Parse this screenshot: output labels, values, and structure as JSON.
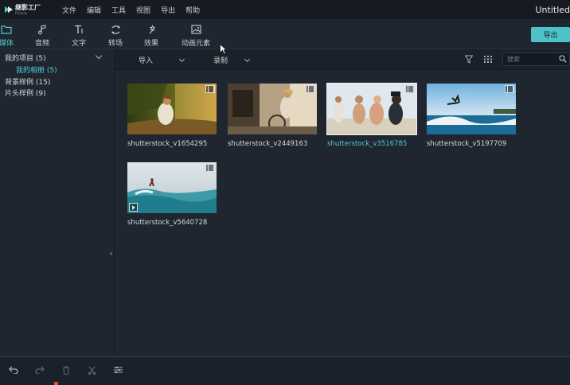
{
  "app": {
    "logo_cn": "继影工厂",
    "logo_en": "Filmora",
    "title": "Untitled"
  },
  "menu": [
    "文件",
    "编辑",
    "工具",
    "视图",
    "导出",
    "帮助"
  ],
  "tabs": [
    {
      "label": "媒体",
      "icon": "folder-icon",
      "active": true
    },
    {
      "label": "音频",
      "icon": "music-note-icon",
      "active": false
    },
    {
      "label": "文字",
      "icon": "text-icon",
      "active": false
    },
    {
      "label": "转场",
      "icon": "transition-icon",
      "active": false
    },
    {
      "label": "效果",
      "icon": "effects-icon",
      "active": false
    },
    {
      "label": "动画元素",
      "icon": "elements-icon",
      "active": false
    }
  ],
  "export_button": "导出",
  "sidebar": {
    "my_project": "我的项目 (5)",
    "my_album": "我的相册 (5)",
    "bg_samples": "背景样例 (15)",
    "intro_samples": "片头样例 (9)"
  },
  "toolbar": {
    "import_label": "导入",
    "record_label": "录制",
    "search_placeholder": "搜索"
  },
  "media": [
    {
      "name": "shutterstock_v1654295",
      "selected": false,
      "type": "video"
    },
    {
      "name": "shutterstock_v2449163",
      "selected": false,
      "type": "video"
    },
    {
      "name": "shutterstock_v3516785",
      "selected": true,
      "type": "video"
    },
    {
      "name": "shutterstock_v5197709",
      "selected": false,
      "type": "video"
    },
    {
      "name": "shutterstock_v5640728",
      "selected": false,
      "type": "video"
    }
  ],
  "colors": {
    "accent": "#54c9d1",
    "export_bg": "#4fc2c8",
    "panel_bg": "#1f2630",
    "titlebar_bg": "#161b22",
    "playhead": "#e0532f"
  }
}
